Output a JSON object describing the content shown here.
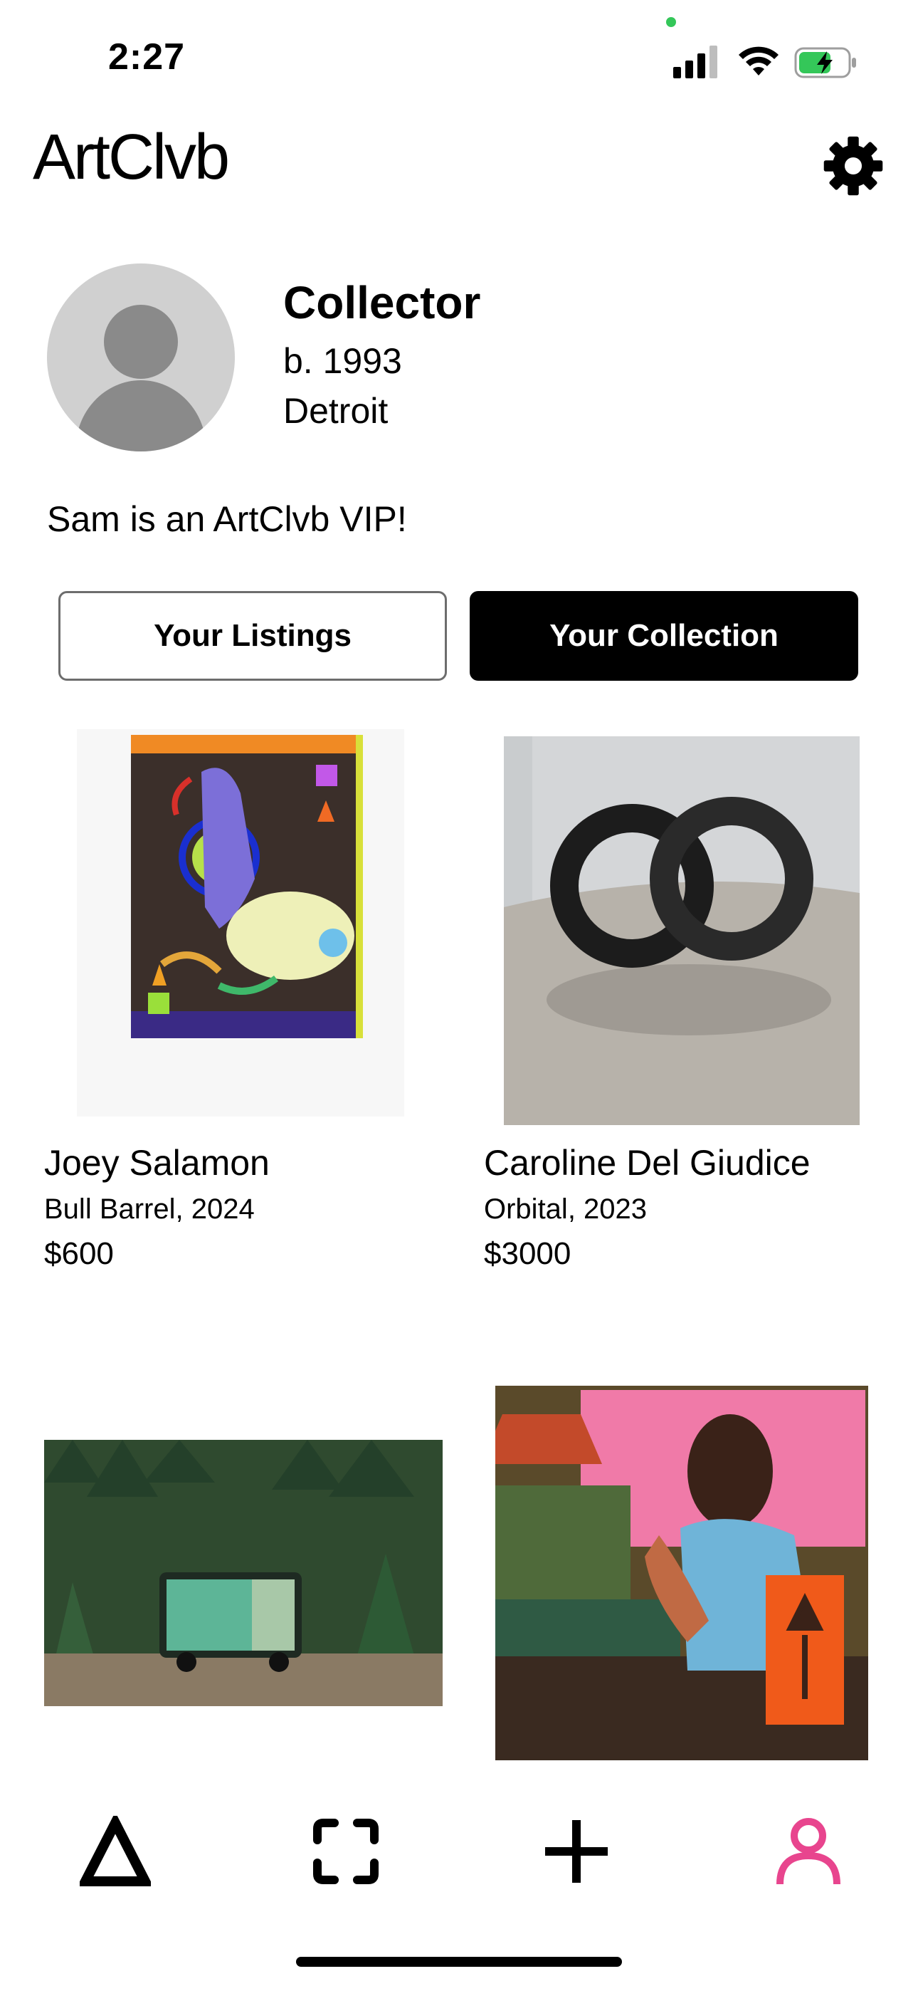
{
  "status_bar": {
    "time": "2:27"
  },
  "header": {
    "logo": "ArtClvb",
    "settings_icon": "gear-icon"
  },
  "profile": {
    "name": "Collector",
    "born": "b. 1993",
    "city": "Detroit",
    "bio": "Sam is an ArtClvb VIP!"
  },
  "tabs": {
    "listings": "Your Listings",
    "collection": "Your Collection",
    "active": "collection"
  },
  "artworks": [
    {
      "artist": "Joey Salamon",
      "title": "Bull Barrel, 2024",
      "price": "$600"
    },
    {
      "artist": "Caroline Del Giudice",
      "title": "Orbital, 2023",
      "price": "$3000"
    },
    {
      "artist": "",
      "title": "",
      "price": ""
    },
    {
      "artist": "",
      "title": "",
      "price": ""
    }
  ],
  "bottom_nav": {
    "items": [
      "delta-logo-icon",
      "scan-icon",
      "plus-icon",
      "profile-icon"
    ],
    "active": "profile-icon",
    "active_color": "#e8458e"
  },
  "colors": {
    "accent": "#e8458e",
    "battery": "#34c759"
  }
}
